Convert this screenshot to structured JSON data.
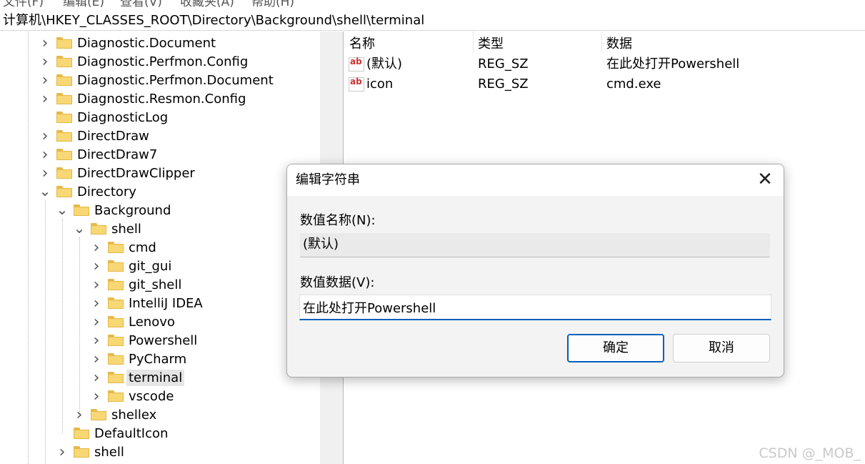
{
  "menu": [
    "文件(F)",
    "编辑(E)",
    "查看(V)",
    "收藏夹(A)",
    "帮助(H)"
  ],
  "address": "计算机\\HKEY_CLASSES_ROOT\\Directory\\Background\\shell\\terminal",
  "tree": [
    {
      "label": "Diagnostic.Document",
      "chevron": "right"
    },
    {
      "label": "Diagnostic.Perfmon.Config",
      "chevron": "right"
    },
    {
      "label": "Diagnostic.Perfmon.Document",
      "chevron": "right"
    },
    {
      "label": "Diagnostic.Resmon.Config",
      "chevron": "right"
    },
    {
      "label": "DiagnosticLog",
      "chevron": ""
    },
    {
      "label": "DirectDraw",
      "chevron": "right"
    },
    {
      "label": "DirectDraw7",
      "chevron": "right"
    },
    {
      "label": "DirectDrawClipper",
      "chevron": "right"
    },
    {
      "label": "Directory",
      "chevron": "down"
    },
    {
      "label": "Background",
      "chevron": "down"
    },
    {
      "label": "shell",
      "chevron": "down"
    },
    {
      "label": "cmd",
      "chevron": "right"
    },
    {
      "label": "git_gui",
      "chevron": "right"
    },
    {
      "label": "git_shell",
      "chevron": "right"
    },
    {
      "label": "IntelliJ IDEA",
      "chevron": "right"
    },
    {
      "label": "Lenovo",
      "chevron": "right"
    },
    {
      "label": "Powershell",
      "chevron": "right"
    },
    {
      "label": "PyCharm",
      "chevron": "right"
    },
    {
      "label": "terminal",
      "chevron": "right",
      "selected": true
    },
    {
      "label": "vscode",
      "chevron": "right"
    },
    {
      "label": "shellex",
      "chevron": "right"
    },
    {
      "label": "DefaultIcon",
      "chevron": ""
    },
    {
      "label": "shell",
      "chevron": "right"
    }
  ],
  "values_table": {
    "headers": {
      "name": "名称",
      "type": "类型",
      "data": "数据"
    },
    "rows": [
      {
        "name": "(默认)",
        "type": "REG_SZ",
        "data": "在此处打开Powershell"
      },
      {
        "name": "icon",
        "type": "REG_SZ",
        "data": "cmd.exe"
      }
    ]
  },
  "dialog": {
    "title": "编辑字符串",
    "name_label": "数值名称(N):",
    "name_value": "(默认)",
    "data_label": "数值数据(V):",
    "data_value": "在此处打开Powershell",
    "ok_label": "确定",
    "cancel_label": "取消",
    "close_glyph": "✕"
  },
  "icons": {
    "value_icon": "ab"
  },
  "watermark": "CSDN @_MOB_",
  "colors": {
    "accent": "#005fb8",
    "folder": "#f8d775"
  }
}
